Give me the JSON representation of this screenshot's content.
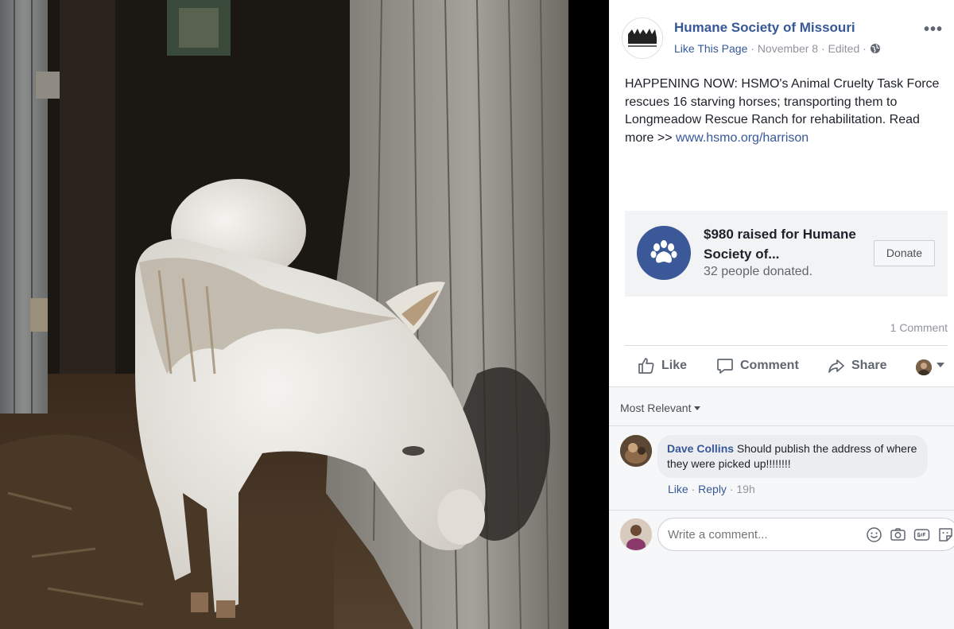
{
  "post": {
    "page_name": "Humane Society of Missouri",
    "like_page": "Like This Page",
    "separator": "·",
    "date": "November 8",
    "edited": "Edited",
    "more": "•••",
    "text_main": "HAPPENING NOW: HSMO's Animal Cruelty Task Force rescues 16 starving horses; transporting them to Longmeadow Rescue Ranch for rehabilitation. Read more >> ",
    "text_link": "www.hsmo.org/harrison"
  },
  "donation": {
    "title": "$980 raised for Humane Society of...",
    "subtitle": "32 people donated.",
    "button": "Donate"
  },
  "stats": {
    "comment_count": "1 Comment"
  },
  "actions": {
    "like": "Like",
    "comment": "Comment",
    "share": "Share"
  },
  "comments": {
    "sort_label": "Most Relevant",
    "items": [
      {
        "author": "Dave Collins",
        "text": " Should publish the address of where they were picked up!!!!!!!!",
        "like": "Like",
        "reply": "Reply",
        "time": "19h",
        "separator": " · "
      }
    ],
    "compose_placeholder": "Write a comment..."
  },
  "colors": {
    "link": "#365899",
    "brand": "#3b5998",
    "muted": "#90949c"
  },
  "icons": [
    "globe-icon",
    "paw-icon",
    "thumbs-up-icon",
    "speech-bubble-icon",
    "share-arrow-icon",
    "emoji-icon",
    "camera-icon",
    "gif-icon",
    "sticker-icon"
  ]
}
